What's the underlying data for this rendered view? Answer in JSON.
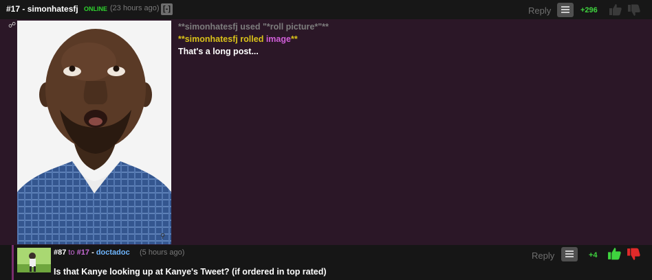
{
  "comment1": {
    "number": "#17",
    "separator": "-",
    "username": "simonhatesfj",
    "online_label": "ONLINE",
    "time": "(23 hours ago)",
    "collapse_label": "[-]",
    "reply_label": "Reply",
    "score": "+296",
    "roll_line": "**simonhatesfj used \"*roll picture*\"**",
    "roll_result_prefix": "**simonhatesfj rolled ",
    "roll_result_link": "image",
    "roll_result_suffix": "**",
    "body": "That's a long post..."
  },
  "comment2": {
    "number": "#87",
    "to_label": "to",
    "parent_number": "#17",
    "separator": "-",
    "username": "doctadoc",
    "time": "(5 hours ago)",
    "reply_label": "Reply",
    "score": "+4",
    "body": "Is that Kanye looking up at Kanye's Tweet? (if ordered in top rated)"
  },
  "colors": {
    "online": "#2fd42f",
    "score": "#3fd43f",
    "roll_gold": "#d9c21a",
    "link_magenta": "#d05ed8",
    "reply_username": "#6fb6ff",
    "thumb_up_active": "#3fd43f",
    "thumb_down_active": "#e02a2a"
  },
  "icons": [
    "picture-icon",
    "zoom-icon",
    "menu-icon",
    "thumb-up-icon",
    "thumb-down-icon"
  ]
}
